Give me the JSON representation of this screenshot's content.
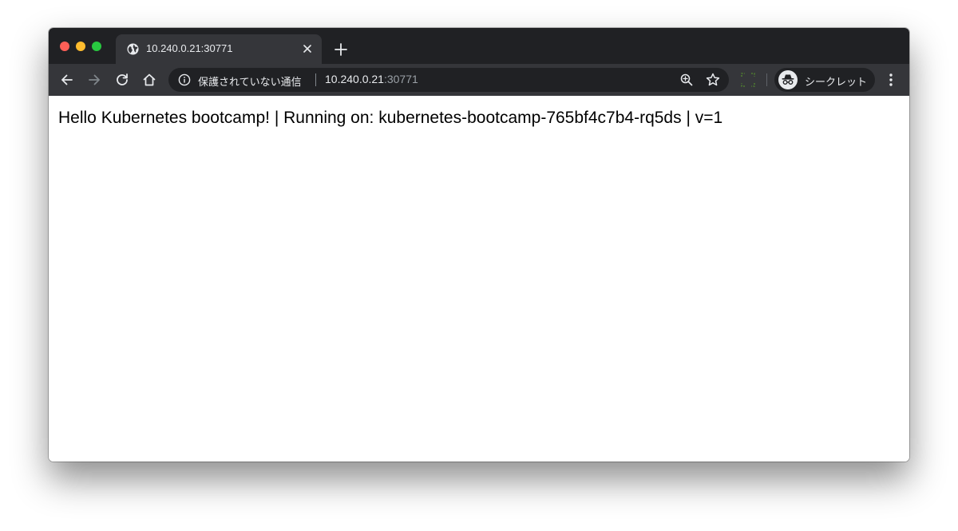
{
  "browser": {
    "tab": {
      "title": "10.240.0.21:30771",
      "icon": "globe-icon"
    },
    "address_bar": {
      "security_label": "保護されていない通信",
      "url_host": "10.240.0.21",
      "url_port": ":30771"
    },
    "profile": {
      "label": "シークレット",
      "icon": "incognito-icon"
    },
    "icons": {
      "back": "back-arrow-icon",
      "forward": "forward-arrow-icon",
      "reload": "reload-icon",
      "home": "home-icon",
      "zoom": "zoom-icon",
      "bookmark": "star-icon",
      "extension": "extension-icon",
      "menu": "kebab-menu-icon"
    }
  },
  "page": {
    "text": "Hello Kubernetes bootcamp! | Running on: kubernetes-bootcamp-765bf4c7b4-rq5ds | v=1"
  },
  "colors": {
    "frame": "#202124",
    "toolbar": "#35363a",
    "text_light": "#e8eaed",
    "text_muted": "#9aa0a6",
    "traffic_close": "#ff5f57",
    "traffic_minimize": "#febc2e",
    "traffic_maximize": "#28c840"
  }
}
